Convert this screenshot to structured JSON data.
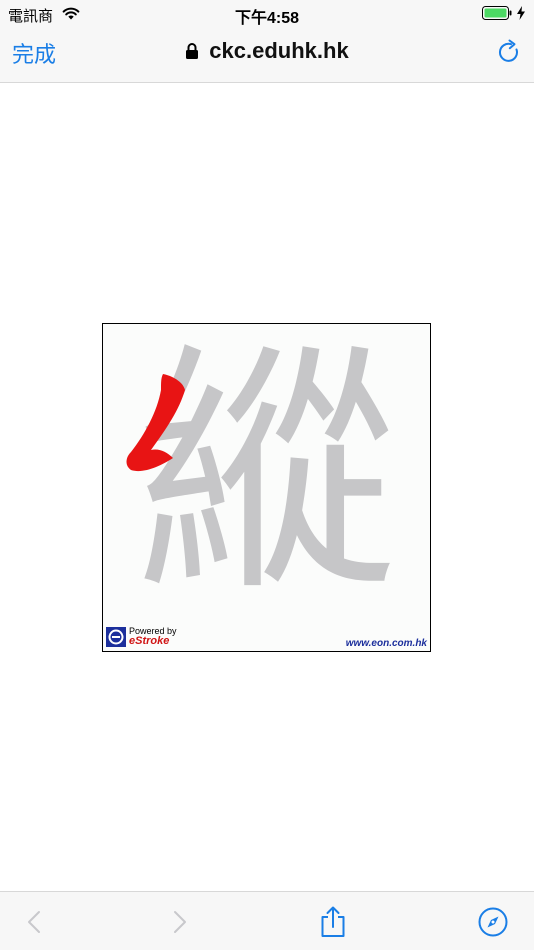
{
  "status_bar": {
    "carrier": "電訊商",
    "time": "下午4:58",
    "icons": [
      "wifi-icon",
      "battery-icon",
      "charging-icon"
    ]
  },
  "nav_bar": {
    "done_label": "完成",
    "url": "ckc.eduhk.hk",
    "icons": [
      "lock-icon",
      "reload-icon"
    ]
  },
  "content": {
    "character": "縱",
    "logo": {
      "powered_by": "Powered by",
      "brand": "eStroke"
    },
    "site_link": "www.eon.com.hk"
  },
  "toolbar": {
    "icons": [
      "back-icon",
      "forward-icon",
      "share-icon",
      "compass-icon"
    ]
  },
  "colors": {
    "accent": "#1a7ee6",
    "highlight_stroke": "#e81414",
    "character_gray": "#c6c6c8",
    "disabled": "#c8c8cc",
    "battery_green": "#4cd964"
  }
}
